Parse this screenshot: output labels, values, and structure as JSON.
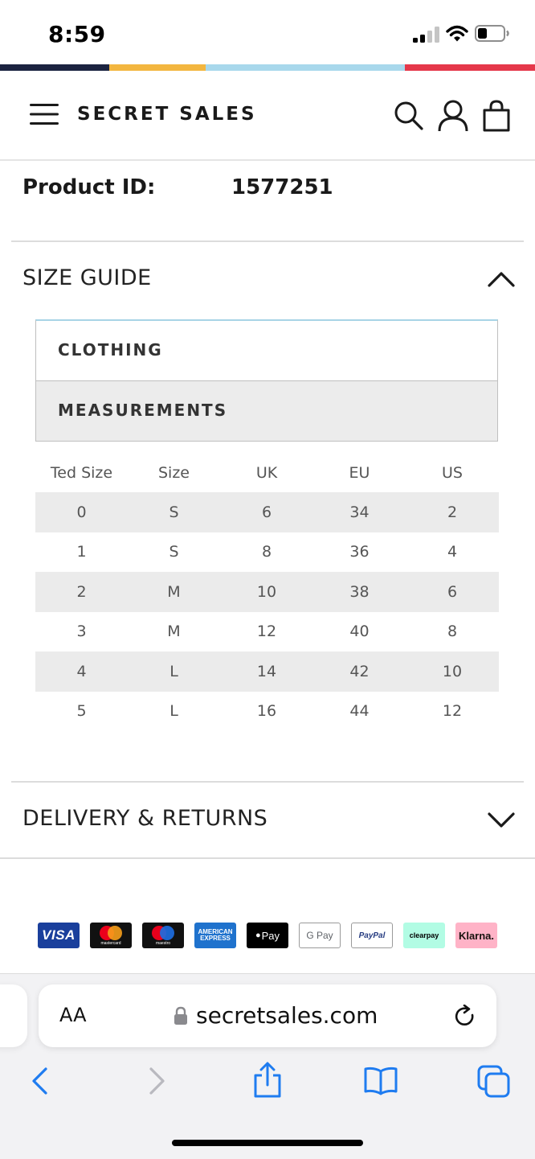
{
  "status_bar": {
    "time": "8:59"
  },
  "brand_stripe_colors": [
    "#1b2340",
    "#f3b63f",
    "#a8d8ec",
    "#e5384a"
  ],
  "header": {
    "logo": "SECRET SALES",
    "icons": [
      "menu-icon",
      "search-icon",
      "account-icon",
      "bag-icon"
    ]
  },
  "product": {
    "id_label": "Product ID:",
    "id_value": "1577251"
  },
  "size_guide": {
    "title": "SIZE GUIDE",
    "tabs": [
      {
        "label": "CLOTHING",
        "active": true
      },
      {
        "label": "MEASUREMENTS",
        "active": false
      }
    ],
    "table": {
      "headers": [
        "Ted Size",
        "Size",
        "UK",
        "EU",
        "US"
      ],
      "rows": [
        [
          "0",
          "S",
          "6",
          "34",
          "2"
        ],
        [
          "1",
          "S",
          "8",
          "36",
          "4"
        ],
        [
          "2",
          "M",
          "10",
          "38",
          "6"
        ],
        [
          "3",
          "M",
          "12",
          "40",
          "8"
        ],
        [
          "4",
          "L",
          "14",
          "42",
          "10"
        ],
        [
          "5",
          "L",
          "16",
          "44",
          "12"
        ]
      ]
    }
  },
  "delivery": {
    "title": "DELIVERY & RETURNS"
  },
  "payments": [
    "VISA",
    "mastercard",
    "maestro",
    "AMERICAN EXPRESS",
    "Pay",
    "G Pay",
    "PayPal",
    "clearpay",
    "Klarna."
  ],
  "browser": {
    "text_size_label": "AA",
    "url": "secretsales.com",
    "accent": "#1f7cf0"
  }
}
